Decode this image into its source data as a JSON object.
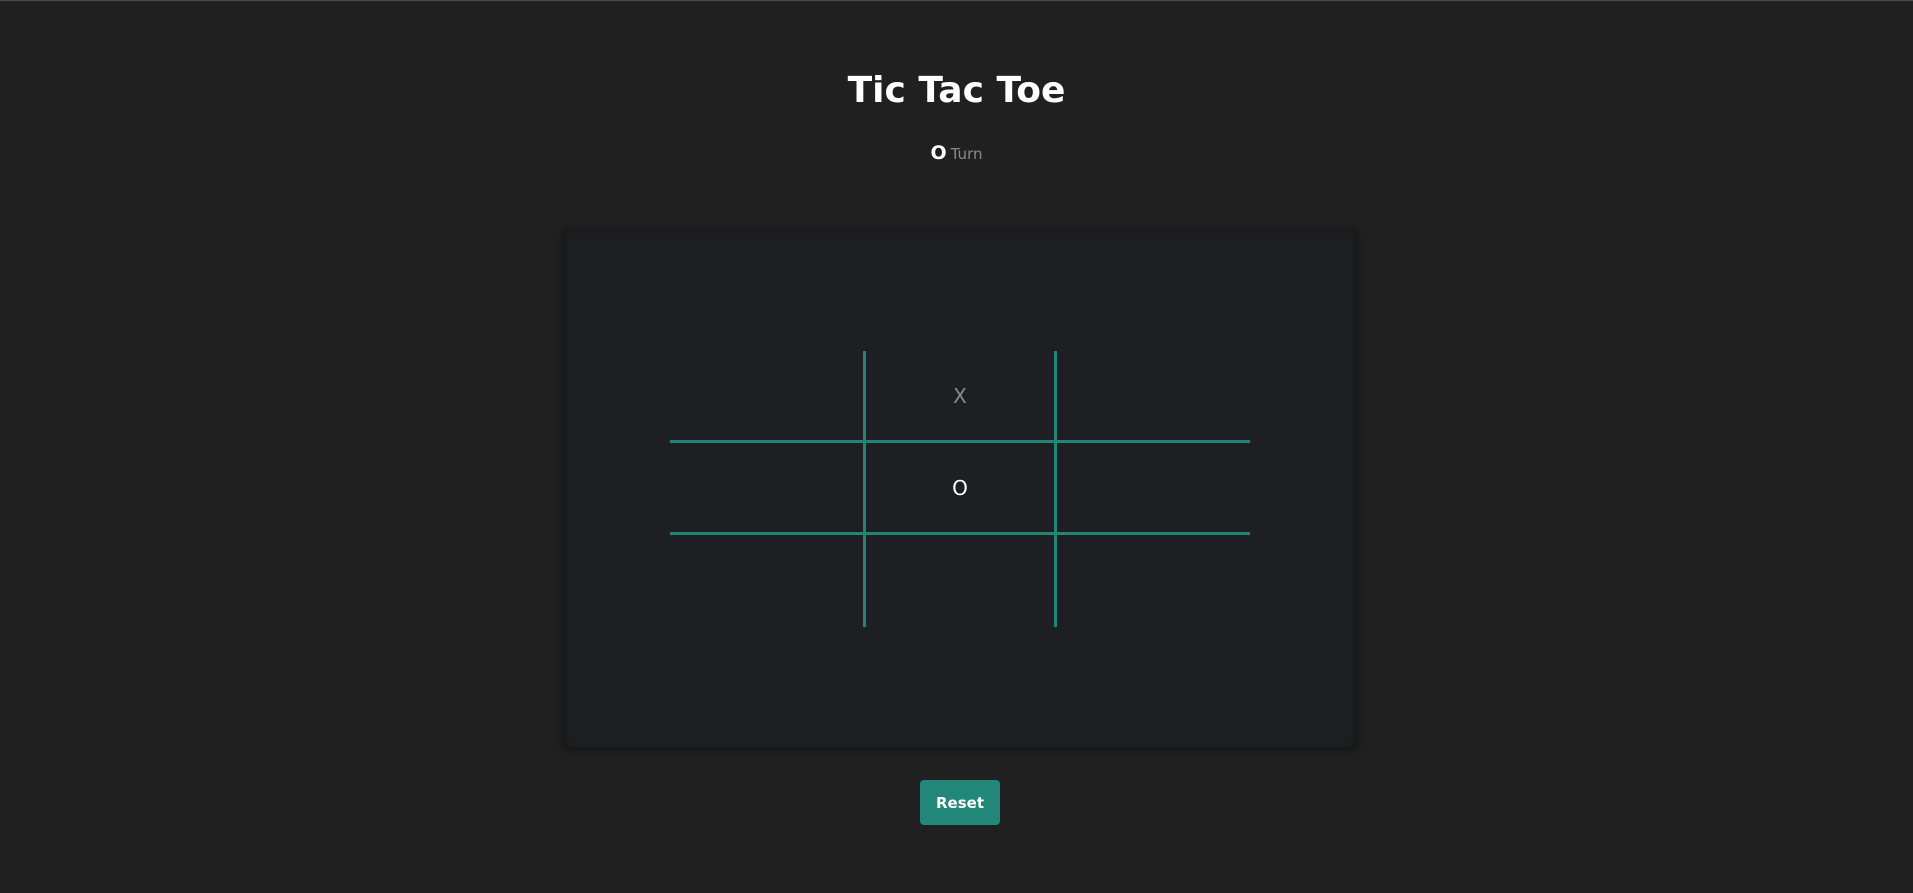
{
  "game": {
    "title": "Tic Tac Toe",
    "current_player": "O",
    "turn_label": "Turn"
  },
  "board": {
    "cells": [
      "",
      "X",
      "",
      "",
      "O",
      "",
      "",
      "",
      ""
    ],
    "line_color": "#1f8678"
  },
  "controls": {
    "reset_label": "Reset",
    "accent_color": "#218779"
  }
}
